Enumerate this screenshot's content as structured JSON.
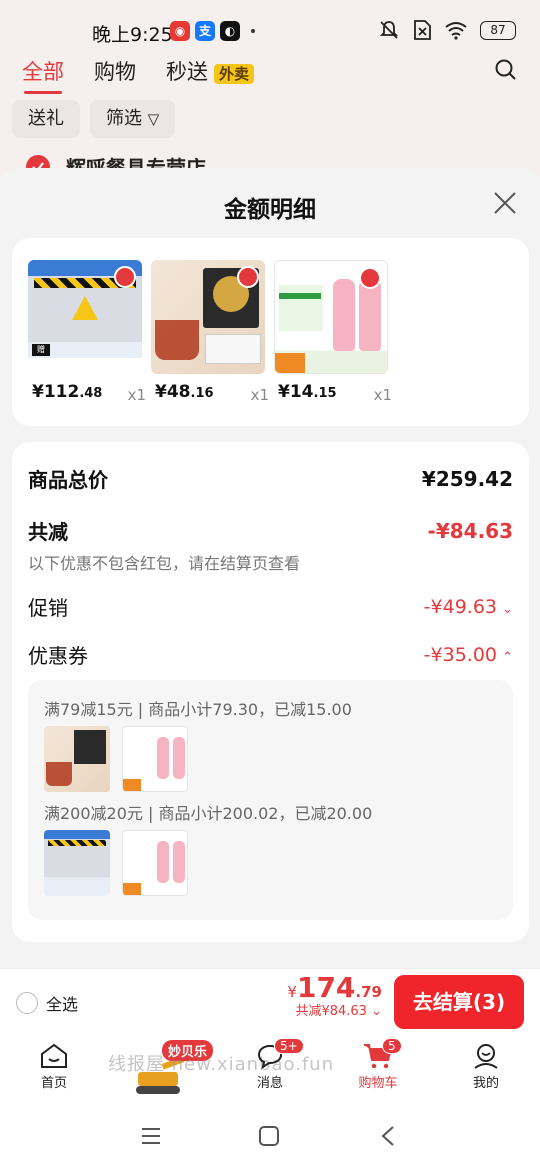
{
  "status_bar": {
    "time": "晚上9:25",
    "battery": "87"
  },
  "top_tabs": [
    "全部",
    "购物",
    "秒送"
  ],
  "takeout_badge": "外卖",
  "filter_chips": [
    "送礼",
    "筛选"
  ],
  "shop_peek": "辉呼餐具专营店",
  "sheet": {
    "title": "金额明细",
    "products": [
      {
        "price_int": "¥112",
        "price_dec": ".48",
        "qty": "x1",
        "icon": "warning-sticker-product"
      },
      {
        "price_int": "¥48",
        "price_dec": ".16",
        "qty": "x1",
        "icon": "tea-box-product"
      },
      {
        "price_int": "¥14",
        "price_dec": ".15",
        "qty": "x1",
        "icon": "juice-bottles-product"
      }
    ],
    "details": {
      "subtotal_label": "商品总价",
      "subtotal_value": "¥259.42",
      "total_discount_label": "共减",
      "total_discount_value": "-¥84.63",
      "note": "以下优惠不包含红包，请在结算页查看",
      "promo_label": "促销",
      "promo_value": "-¥49.63",
      "coupon_label": "优惠券",
      "coupon_value": "-¥35.00",
      "coupon_rules": [
        "满79减15元 | 商品小计79.30，已减15.00",
        "满200减20元 | 商品小计200.02，已减20.00"
      ]
    }
  },
  "checkout": {
    "select_all": "全选",
    "currency": "¥",
    "total_int": "174",
    "total_dec": ".79",
    "discount_text": "共减¥84.63",
    "button": "去结算(3)"
  },
  "tabbar": {
    "home": "首页",
    "promo_badge": "妙贝乐",
    "messages": "消息",
    "messages_badge": "5+",
    "cart": "购物车",
    "cart_badge": "5",
    "mine": "我的",
    "watermark": "线报屋 new.xianbao.fun"
  },
  "colors": {
    "accent": "#e4393c",
    "button": "#f0252b"
  }
}
